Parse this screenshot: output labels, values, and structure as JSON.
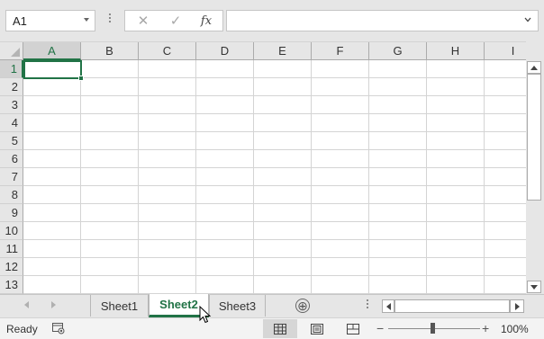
{
  "name_box": {
    "value": "A1"
  },
  "formula_bar": {
    "cancel_icon": "✕",
    "enter_icon": "✓",
    "fx_label": "fx",
    "value": ""
  },
  "columns": [
    "A",
    "B",
    "C",
    "D",
    "E",
    "F",
    "G",
    "H",
    "I"
  ],
  "rows": [
    "1",
    "2",
    "3",
    "4",
    "5",
    "6",
    "7",
    "8",
    "9",
    "10",
    "11",
    "12",
    "13"
  ],
  "active_cell": {
    "column": "A",
    "row": "1"
  },
  "sheets": {
    "tabs": [
      "Sheet1",
      "Sheet2",
      "Sheet3"
    ],
    "active": "Sheet2",
    "add_icon": "⊕"
  },
  "status": {
    "ready": "Ready",
    "zoom_out": "−",
    "zoom_in": "+",
    "zoom": "100%"
  },
  "colors": {
    "accent": "#217346"
  }
}
